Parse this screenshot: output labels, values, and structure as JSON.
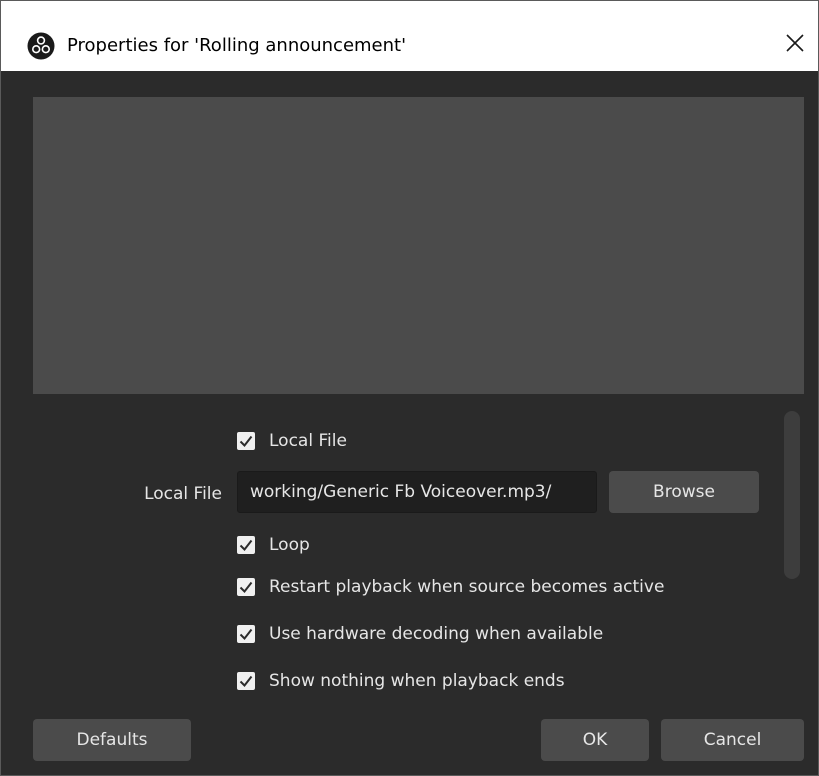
{
  "window": {
    "title": "Properties for 'Rolling announcement'",
    "app_icon": "obs-logo-icon",
    "close_icon": "close-icon"
  },
  "properties": {
    "local_file_checkbox": {
      "label": "Local File",
      "checked": true
    },
    "local_file_field": {
      "label": "Local File",
      "value": "/working/Generic Fb Voiceover.mp3",
      "browse_label": "Browse"
    },
    "loop_checkbox": {
      "label": "Loop",
      "checked": true
    },
    "restart_checkbox": {
      "label": "Restart playback when source becomes active",
      "checked": true
    },
    "hw_decoding_checkbox": {
      "label": "Use hardware decoding when available",
      "checked": true
    },
    "show_nothing_checkbox": {
      "label": "Show nothing when playback ends",
      "checked": true
    }
  },
  "footer": {
    "defaults_label": "Defaults",
    "ok_label": "OK",
    "cancel_label": "Cancel"
  },
  "colors": {
    "dialog_bg": "#2b2b2b",
    "preview_bg": "#4b4b4b",
    "button_bg": "#4b4b4b",
    "input_bg": "#1f1f1f",
    "text": "#e6e6e6",
    "titlebar_bg": "#ffffff"
  }
}
